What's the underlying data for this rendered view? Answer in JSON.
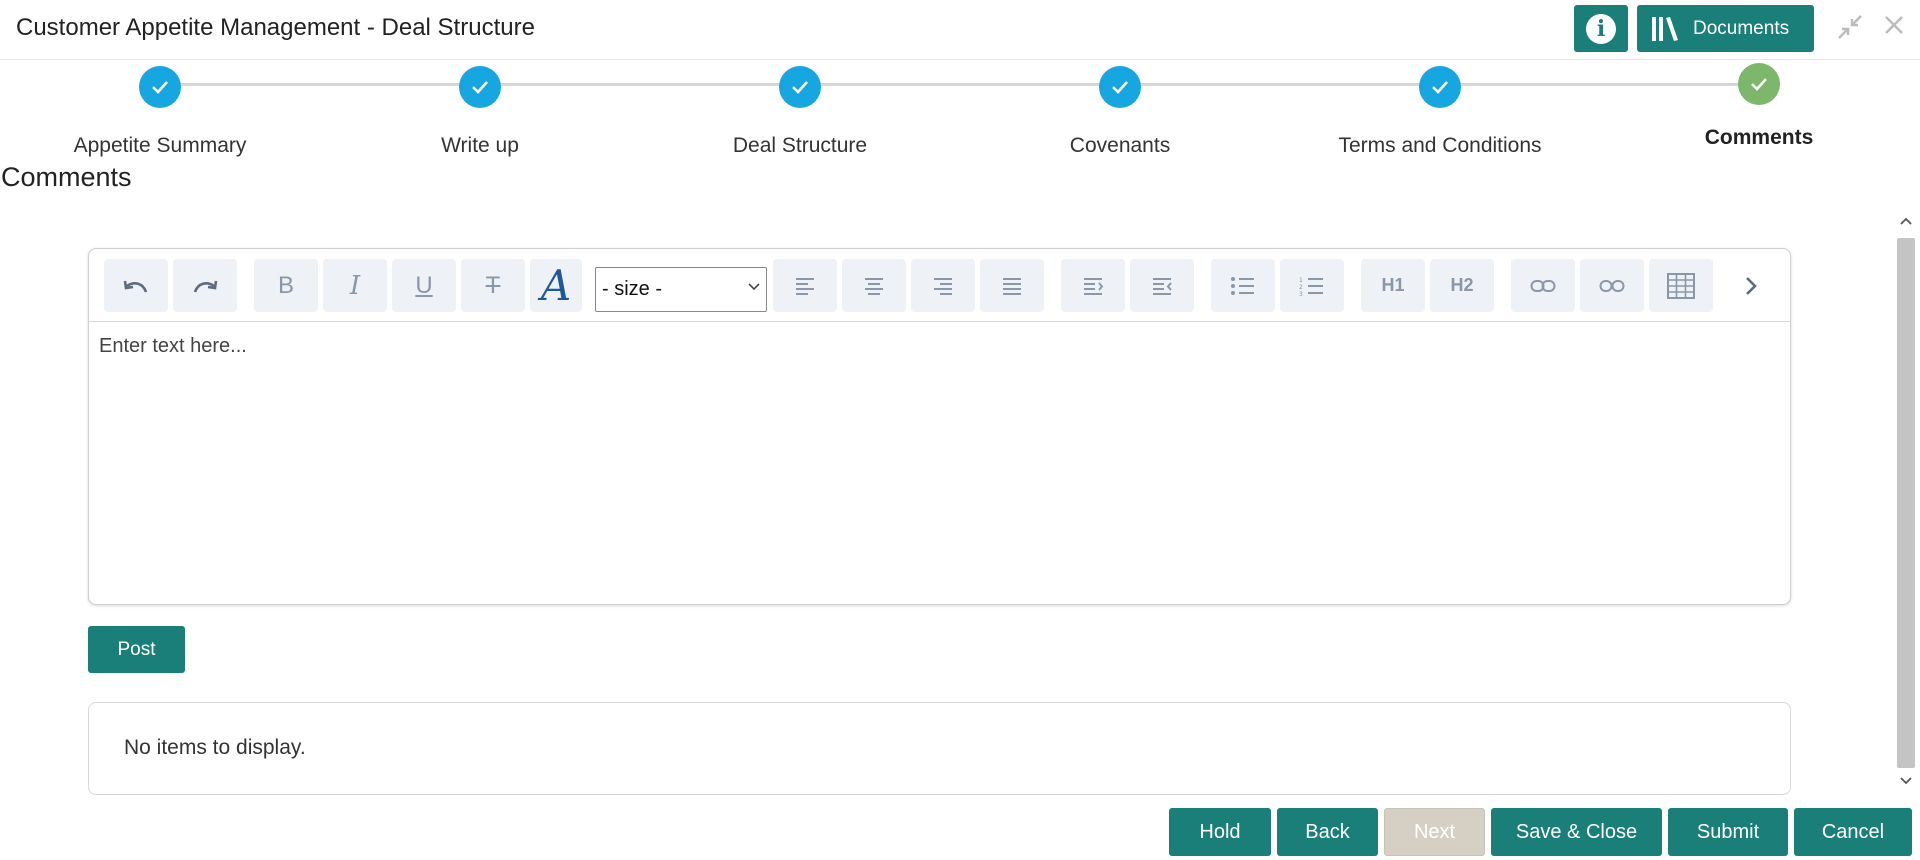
{
  "header": {
    "title": "Customer Appetite Management - Deal Structure",
    "info_icon": "info-icon",
    "documents_label": "Documents",
    "minimize_icon": "minimize-icon",
    "close_icon": "close-icon",
    "accent_color": "#1a7f78"
  },
  "stepper": {
    "steps": [
      {
        "label": "Appetite Summary",
        "status": "complete"
      },
      {
        "label": "Write up",
        "status": "complete"
      },
      {
        "label": "Deal Structure",
        "status": "complete"
      },
      {
        "label": "Covenants",
        "status": "complete"
      },
      {
        "label": "Terms and Conditions",
        "status": "complete"
      },
      {
        "label": "Comments",
        "status": "current"
      }
    ],
    "complete_color": "#16a7e0",
    "current_color": "#7cb76b"
  },
  "section": {
    "title": "Comments"
  },
  "editor": {
    "toolbar": {
      "undo": "undo-icon",
      "redo": "redo-icon",
      "bold": "B",
      "italic": "I",
      "underline": "U",
      "strikethrough": "T",
      "font_color": "A",
      "size_select": "- size -",
      "align_left": "align-left-icon",
      "align_center": "align-center-icon",
      "align_right": "align-right-icon",
      "align_justify": "align-justify-icon",
      "indent": "indent-icon",
      "outdent": "outdent-icon",
      "bullet_list": "bullet-list-icon",
      "numbered_list": "numbered-list-icon",
      "h1": "H1",
      "h2": "H2",
      "link": "link-icon",
      "unlink": "unlink-icon",
      "table": "table-icon",
      "more": "chevron-right-icon"
    },
    "placeholder": "Enter text here..."
  },
  "post_label": "Post",
  "comments_list": {
    "empty_text": "No items to display."
  },
  "footer": {
    "hold": "Hold",
    "back": "Back",
    "next": "Next",
    "save_close": "Save & Close",
    "submit": "Submit",
    "cancel": "Cancel"
  }
}
